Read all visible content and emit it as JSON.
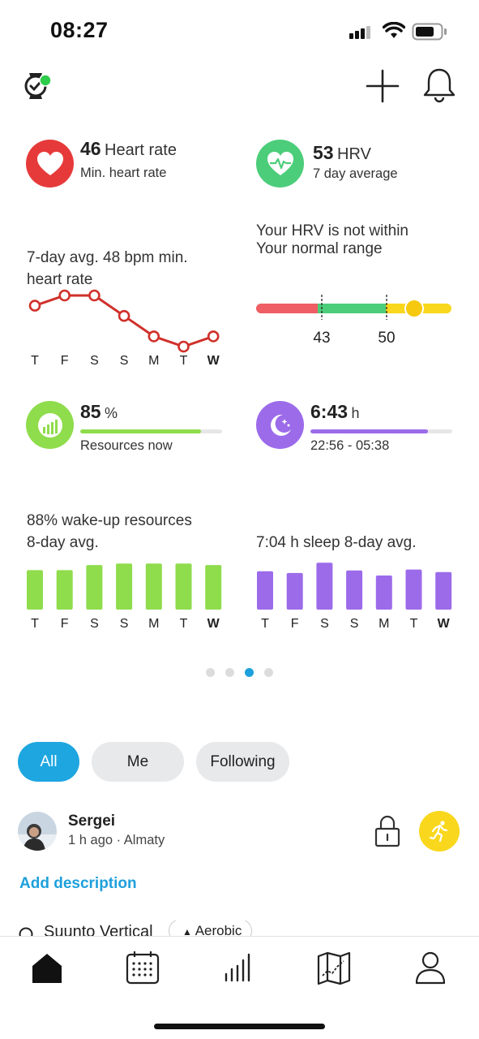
{
  "status_bar": {
    "time": "08:27"
  },
  "widgets": {
    "heart_rate": {
      "value": "46",
      "unit": "Heart rate",
      "subtitle": "Min. heart rate",
      "icon": "heart-icon",
      "color": "#e63a3a"
    },
    "hrv": {
      "value": "53",
      "unit": "HRV",
      "subtitle": "7 day average",
      "icon": "heart-pulse-icon",
      "color": "#4ccd7a"
    },
    "hr_chart": {
      "caption_line1": "7-day avg. 48 bpm min.",
      "caption_line2": "heart rate",
      "days": [
        "T",
        "F",
        "S",
        "S",
        "M",
        "T",
        "W"
      ]
    },
    "hrv_status": {
      "line1": "Your HRV is not within",
      "line2": "Your normal range",
      "range_low": "43",
      "range_high": "50",
      "current": 53,
      "colors": {
        "low": "#ee5e64",
        "normal": "#4ccd7a",
        "high": "#f9d71c"
      }
    },
    "resources": {
      "value": "85",
      "unit": "%",
      "subtitle": "Resources now",
      "progress": 0.85,
      "icon": "resources-icon",
      "color": "#8fdc4c"
    },
    "sleep": {
      "value": "6:43",
      "unit": "h",
      "subtitle": "22:56 - 05:38",
      "progress": 0.83,
      "icon": "moon-icon",
      "color": "#9c6bea"
    },
    "resources_chart": {
      "caption_line1": "88% wake-up resources",
      "caption_line2": "8-day avg.",
      "days": [
        "T",
        "F",
        "S",
        "S",
        "M",
        "T",
        "W"
      ]
    },
    "sleep_chart": {
      "caption_line1": "7:04 h sleep 8-day avg.",
      "days": [
        "T",
        "F",
        "S",
        "S",
        "M",
        "T",
        "W"
      ]
    }
  },
  "chart_data": [
    {
      "type": "line",
      "x": [
        "T",
        "F",
        "S",
        "S",
        "M",
        "T",
        "W"
      ],
      "values": [
        49,
        50,
        50,
        48,
        46,
        45,
        46
      ],
      "color": "#d0302a"
    },
    {
      "type": "bar",
      "categories": [
        "T",
        "F",
        "S",
        "S",
        "M",
        "T",
        "W"
      ],
      "values": [
        84,
        84,
        91,
        93,
        93,
        93,
        91
      ],
      "color": "#8fdc4c"
    },
    {
      "type": "bar",
      "categories": [
        "T",
        "F",
        "S",
        "S",
        "M",
        "T",
        "W"
      ],
      "values": [
        7.0,
        6.8,
        8.0,
        7.1,
        6.5,
        7.2,
        6.9
      ],
      "color": "#9c6bea"
    }
  ],
  "pager": {
    "count": 4,
    "active": 2
  },
  "feed": {
    "filters": [
      "All",
      "Me",
      "Following"
    ],
    "active_filter": "All",
    "post": {
      "user": "Sergei",
      "meta": "1 h ago · Almaty",
      "add_description": "Add description",
      "device": "Suunto Vertical",
      "tag": "Aerobic"
    }
  },
  "tab_bar": [
    "home-icon",
    "calendar-icon",
    "stats-icon",
    "map-icon",
    "profile-icon"
  ]
}
